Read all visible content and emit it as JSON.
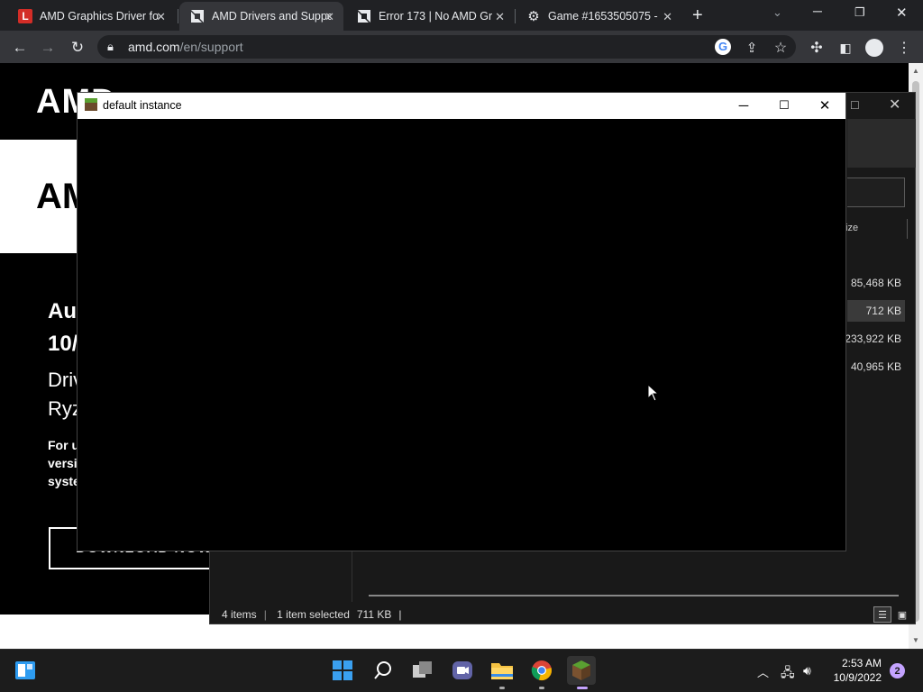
{
  "browser": {
    "tabs": [
      {
        "title": "AMD Graphics Driver for",
        "icon": "lastpass-l-icon",
        "active": false
      },
      {
        "title": "AMD Drivers and Support",
        "icon": "amd-logo-icon",
        "active": true
      },
      {
        "title": "Error 173 | No AMD Gr",
        "icon": "amd-logo-icon",
        "active": false
      },
      {
        "title": "Game #1653505075 - ",
        "icon": "gear-icon",
        "active": false
      }
    ],
    "url_host": "amd.com",
    "url_path": "/en/support"
  },
  "page": {
    "logo": "AMD",
    "heading": "AM",
    "h3_line1": "Aut",
    "h3_line2": "10/",
    "sub_line1": "Driv",
    "sub_line2": "Ryz",
    "para_line1": "For u",
    "para_line2": "versi",
    "para_line3": "syste",
    "download_button": "DOWNLOAD NOW"
  },
  "explorer": {
    "column_size": "ize",
    "rows": [
      {
        "size": "85,468 KB"
      },
      {
        "size": "712 KB",
        "selected": true
      },
      {
        "size": "233,922 KB"
      },
      {
        "size": "40,965 KB"
      }
    ],
    "status_items": "4 items",
    "status_selected": "1 item selected",
    "status_size": "711 KB"
  },
  "minecraft": {
    "title": "default instance"
  },
  "taskbar": {
    "time": "2:53 AM",
    "date": "10/9/2022",
    "notifications": "2"
  }
}
